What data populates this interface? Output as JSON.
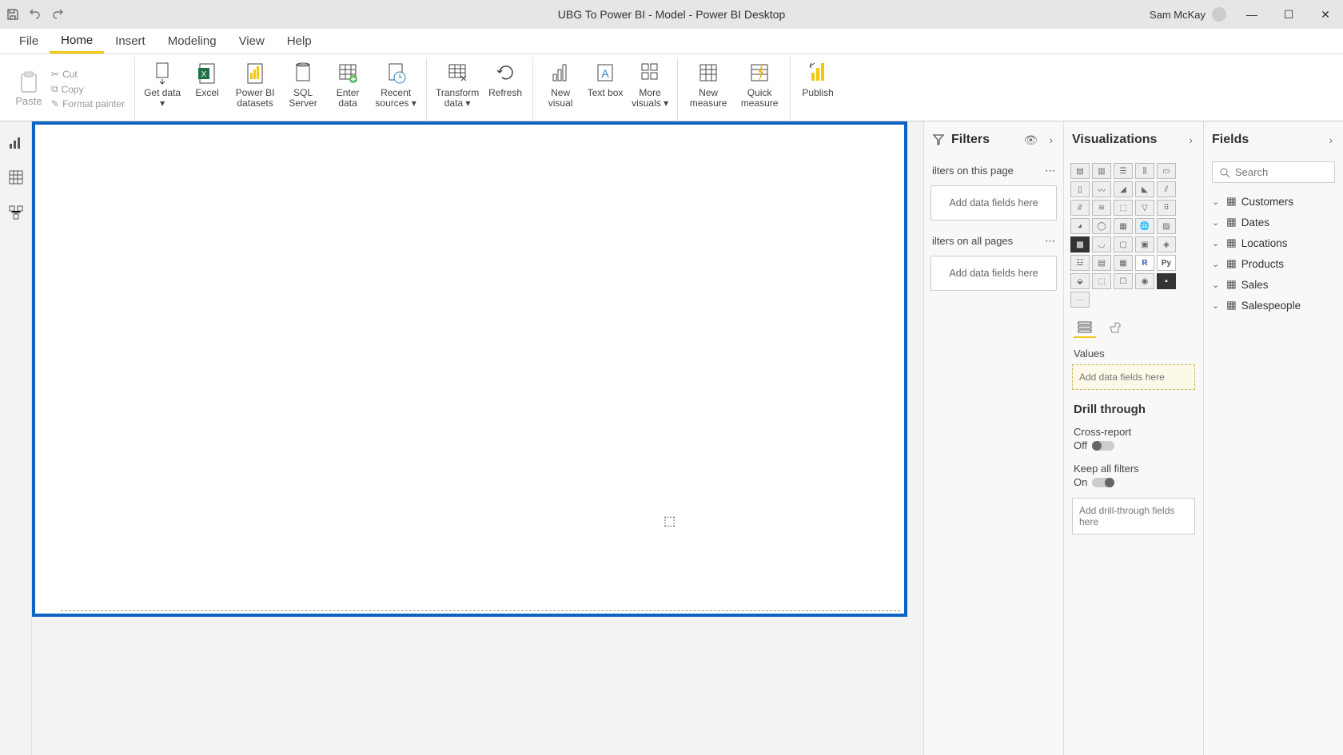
{
  "titlebar": {
    "title": "UBG To Power BI - Model - Power BI Desktop",
    "user": "Sam McKay"
  },
  "menus": {
    "file": "File",
    "home": "Home",
    "insert": "Insert",
    "modeling": "Modeling",
    "view": "View",
    "help": "Help"
  },
  "clipboard": {
    "paste": "Paste",
    "cut": "Cut",
    "copy": "Copy",
    "format_painter": "Format painter"
  },
  "ribbon": {
    "get_data": "Get data",
    "excel": "Excel",
    "pbi_datasets": "Power BI datasets",
    "sql_server": "SQL Server",
    "enter_data": "Enter data",
    "recent_sources": "Recent sources",
    "transform_data": "Transform data",
    "refresh": "Refresh",
    "new_visual": "New visual",
    "text_box": "Text box",
    "more_visuals": "More visuals",
    "new_measure": "New measure",
    "quick_measure": "Quick measure",
    "publish": "Publish"
  },
  "filters": {
    "title": "Filters",
    "on_page": "ilters on this page",
    "on_all": "ilters on all pages",
    "add_here": "Add data fields here"
  },
  "viz": {
    "title": "Visualizations",
    "values": "Values",
    "add_here": "Add data fields here",
    "drill": "Drill through",
    "cross": "Cross-report",
    "off": "Off",
    "keep": "Keep all filters",
    "on": "On",
    "add_drill": "Add drill-through fields here"
  },
  "fields": {
    "title": "Fields",
    "search": "Search",
    "tables": [
      "Customers",
      "Dates",
      "Locations",
      "Products",
      "Sales",
      "Salespeople"
    ]
  }
}
